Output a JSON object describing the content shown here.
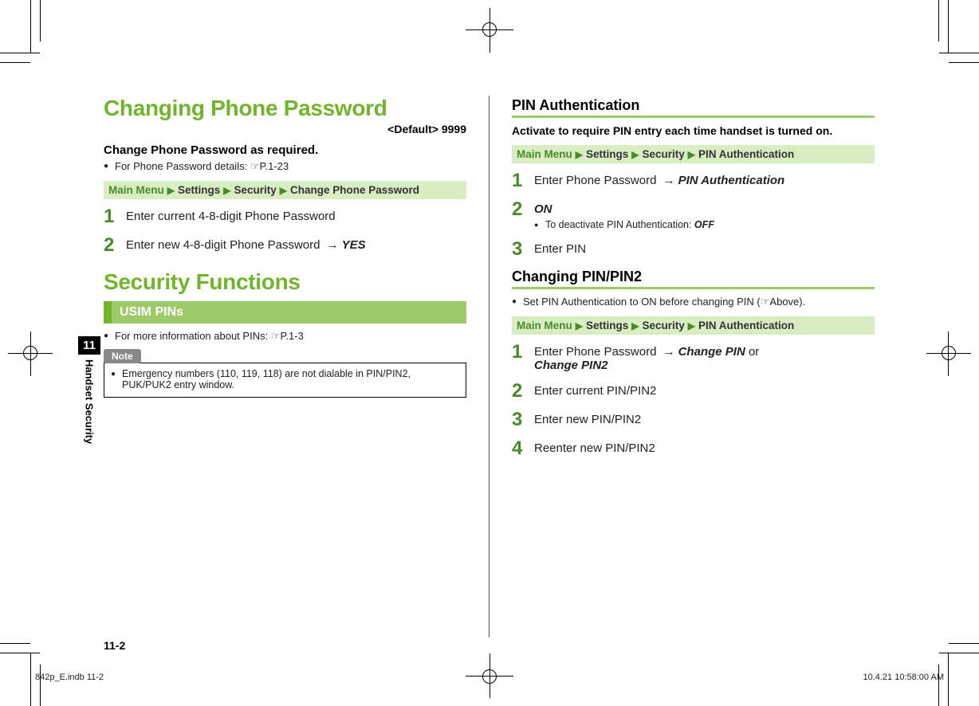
{
  "chapter": {
    "number": "11",
    "title": "Handset Security"
  },
  "left": {
    "heading": "Changing Phone Password",
    "default": "<Default> 9999",
    "intro": "Change Phone Password as required.",
    "detailsRef": "For Phone Password details: ☞P.1-23",
    "nav": {
      "mm": "Main Menu",
      "p1": "Settings",
      "p2": "Security",
      "p3": "Change Phone Password"
    },
    "step1": "Enter current 4-8-digit Phone Password",
    "step2_text": "Enter new 4-8-digit Phone Password ",
    "step2_yes": "YES",
    "secFuncHeading": "Security Functions",
    "usimTitle": "USIM PINs",
    "pinRef": "For more information about PINs: ☞P.1-3",
    "noteLabel": "Note",
    "noteText": "Emergency numbers (110, 119, 118) are not dialable in PIN/PIN2, PUK/PUK2 entry window."
  },
  "right": {
    "h2a": "PIN Authentication",
    "introA": "Activate to require PIN entry each time handset is turned on.",
    "navA": {
      "mm": "Main Menu",
      "p1": "Settings",
      "p2": "Security",
      "p3": "PIN Authentication"
    },
    "a1_text": "Enter Phone Password ",
    "a1_action": "PIN Authentication",
    "a2_on": "ON",
    "a2_sub_text": "To deactivate PIN Authentication: ",
    "a2_sub_off": "OFF",
    "a3": "Enter PIN",
    "h2b": "Changing PIN/PIN2",
    "bPre_a": "Set ",
    "bPre_b": "PIN Authentication",
    "bPre_c": " to ",
    "bPre_d": "ON",
    "bPre_e": " before changing PIN (☞Above).",
    "navB": {
      "mm": "Main Menu",
      "p1": "Settings",
      "p2": "Security",
      "p3": "PIN Authentication"
    },
    "b1_text": "Enter Phone Password ",
    "b1_action": "Change PIN",
    "b1_or": " or ",
    "b1_action2": "Change PIN2",
    "b2": "Enter current PIN/PIN2",
    "b3": "Enter new PIN/PIN2",
    "b4": "Reenter new PIN/PIN2"
  },
  "pageNumber": "11-2",
  "footer": {
    "left": "842p_E.indb   11-2",
    "right": "10.4.21   10:58:00 AM"
  }
}
